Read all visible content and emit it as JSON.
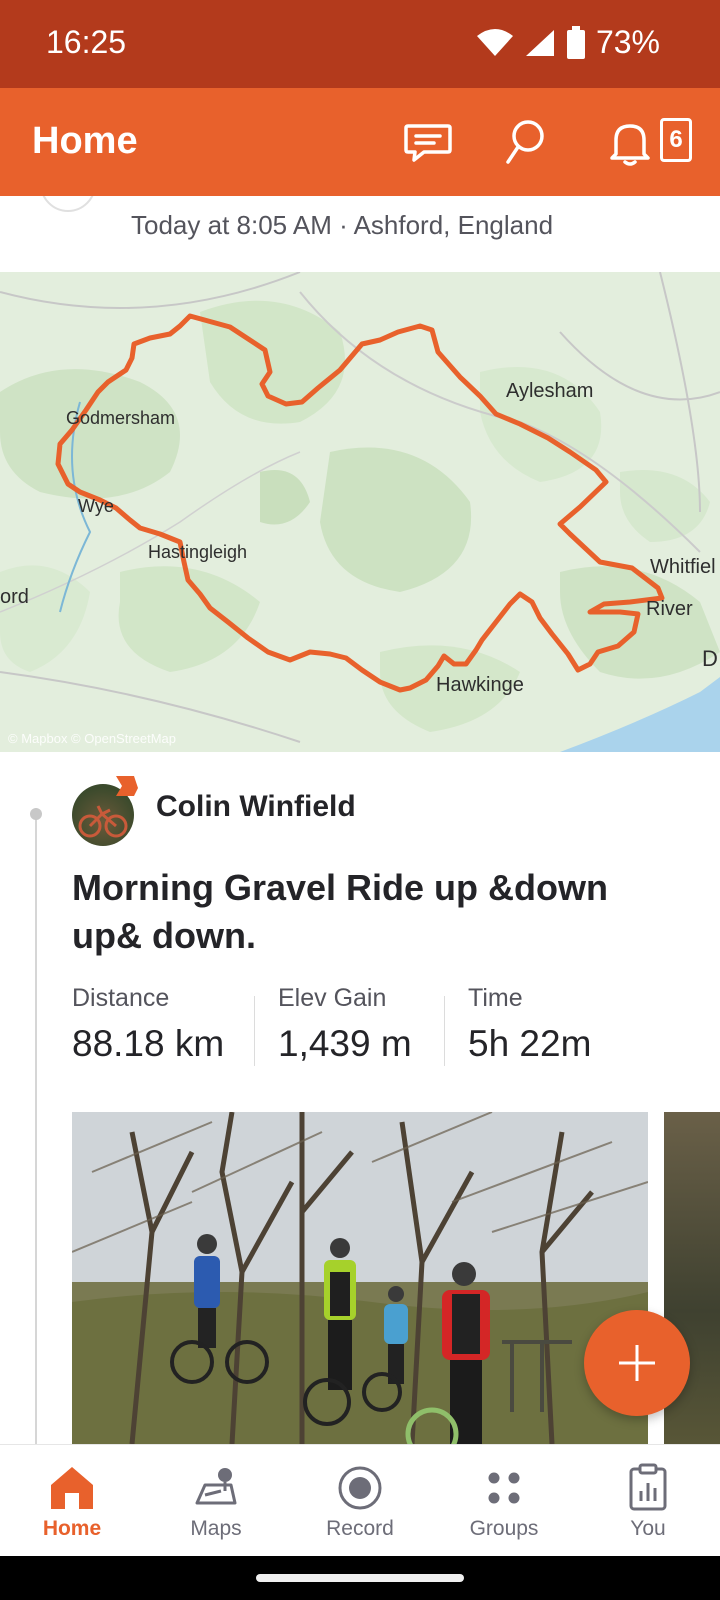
{
  "status_bar": {
    "time": "16:25",
    "battery_percent": "73%"
  },
  "app_bar": {
    "title": "Home",
    "icons": [
      "chat-icon",
      "search-icon",
      "bell-icon"
    ],
    "notification_count": "6"
  },
  "previous_activity": {
    "meta": "Today at 8:05 AM · Ashford, England"
  },
  "map": {
    "labels": {
      "godmersham": "Godmersham",
      "wye": "Wye",
      "hastingleigh": "Hastingleigh",
      "aylesham": "Aylesham",
      "whitfield": "Whitfiel",
      "river": "River",
      "hawkinge": "Hawkinge",
      "ord": "ord",
      "d": "D"
    },
    "attribution": "© Mapbox © OpenStreetMap",
    "route_color": "#e8612c"
  },
  "activity": {
    "athlete_name": "Colin Winfield",
    "title": "Morning Gravel Ride up &down up& down.",
    "stats": [
      {
        "label": "Distance",
        "value": "88.18 km"
      },
      {
        "label": "Elev Gain",
        "value": "1,439 m"
      },
      {
        "label": "Time",
        "value": "5h 22m"
      }
    ]
  },
  "fab": {
    "icon": "plus-icon"
  },
  "bottom_nav": {
    "items": [
      {
        "label": "Home",
        "icon": "home-icon",
        "active": true
      },
      {
        "label": "Maps",
        "icon": "map-icon",
        "active": false
      },
      {
        "label": "Record",
        "icon": "record-icon",
        "active": false
      },
      {
        "label": "Groups",
        "icon": "groups-icon",
        "active": false
      },
      {
        "label": "You",
        "icon": "you-icon",
        "active": false
      }
    ]
  },
  "colors": {
    "brand": "#e8612c",
    "status_bar": "#b33a1c"
  }
}
